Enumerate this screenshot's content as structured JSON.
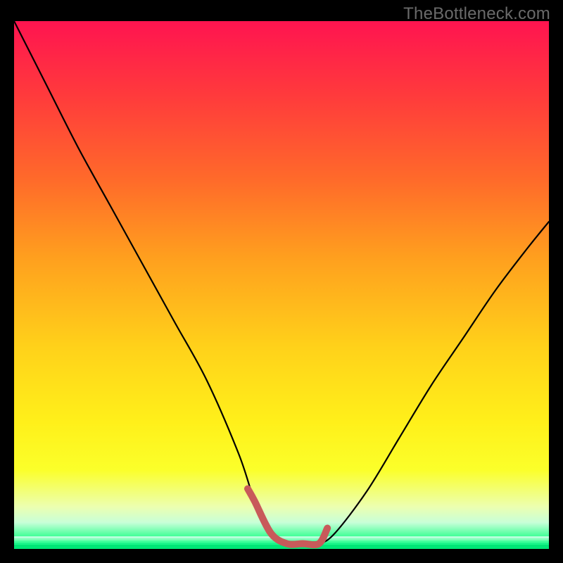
{
  "watermark": {
    "text": "TheBottleneck.com"
  },
  "chart_data": {
    "type": "line",
    "title": "",
    "xlabel": "",
    "ylabel": "",
    "xlim": [
      0,
      100
    ],
    "ylim": [
      0,
      100
    ],
    "series": [
      {
        "name": "bottleneck-curve",
        "x": [
          0,
          6,
          12,
          18,
          24,
          30,
          36,
          42,
          45,
          48,
          51,
          54,
          57,
          60,
          66,
          72,
          78,
          84,
          90,
          96,
          100
        ],
        "values": [
          100,
          88,
          76,
          65,
          54,
          43,
          32,
          18,
          9,
          3,
          1,
          1,
          1,
          3,
          11,
          21,
          31,
          40,
          49,
          57,
          62
        ]
      }
    ],
    "annotations": [
      {
        "name": "trough-marker",
        "x_range": [
          45,
          58
        ],
        "y": 2,
        "color": "#c85a5a"
      }
    ],
    "background_gradient": {
      "direction": "vertical",
      "stops": [
        {
          "pos": 0,
          "color": "#ff1450"
        },
        {
          "pos": 50,
          "color": "#ffb020"
        },
        {
          "pos": 85,
          "color": "#fff01a"
        },
        {
          "pos": 100,
          "color": "#00e676"
        }
      ]
    }
  },
  "colors": {
    "curve": "#000000",
    "trough_marker": "#c85a5a",
    "frame_background": "#000000"
  }
}
